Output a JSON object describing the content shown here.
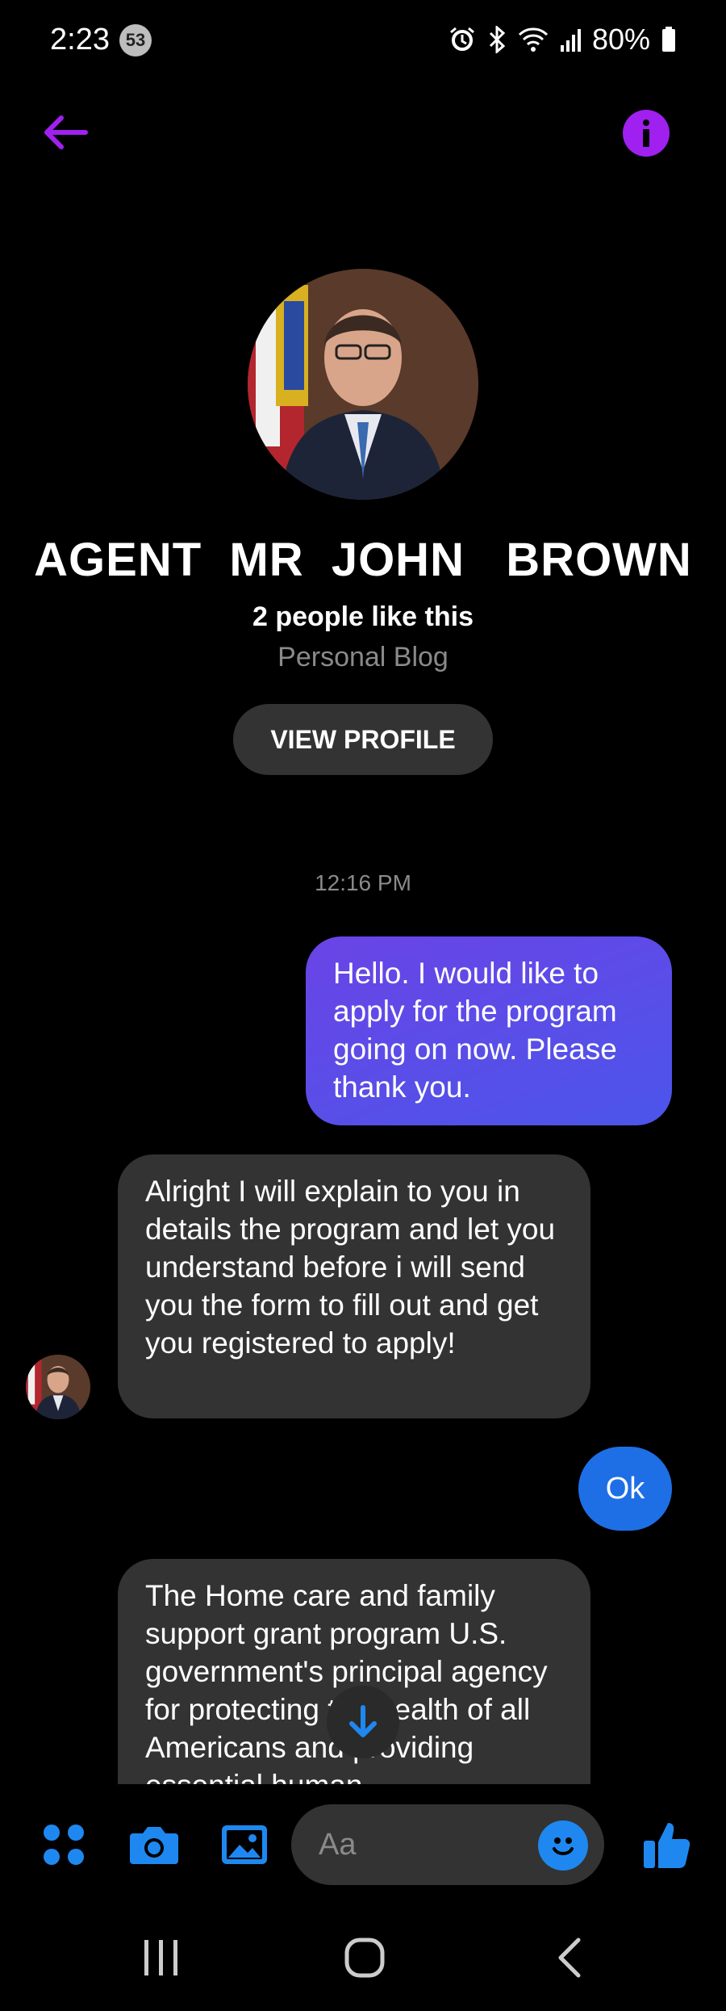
{
  "status_bar": {
    "time": "2:23",
    "notification_count": "53",
    "battery": "80%",
    "icons": [
      "alarm-icon",
      "bluetooth-icon",
      "wifi-icon",
      "signal-icon",
      "battery-icon"
    ]
  },
  "header": {
    "back_icon": "arrow-left-icon",
    "info_icon": "info-icon",
    "accent_color": "#a020f0"
  },
  "profile": {
    "name": "AGENT  MR  JOHN   BROWN",
    "likes": "2 people like this",
    "category": "Personal Blog",
    "view_profile_label": "VIEW PROFILE"
  },
  "conversation": {
    "timestamp": "12:16 PM",
    "messages": [
      {
        "direction": "sent",
        "text": "Hello. I would like to apply for the program going on now. Please thank you."
      },
      {
        "direction": "received",
        "text": "Alright I will explain to you in details the program and let you understand before i will send you the form to fill out and get you registered to apply!"
      },
      {
        "direction": "sent",
        "text": "Ok"
      },
      {
        "direction": "received",
        "text": "The Home care and family support grant program U.S. government's principal agency for protecting the health of all Americans and providing essential human"
      }
    ]
  },
  "composer": {
    "placeholder": "Aa",
    "tools": [
      "apps-icon",
      "camera-icon",
      "gallery-icon"
    ],
    "emoji_icon": "smiley-icon",
    "like_icon": "thumbs-up-icon",
    "accent_color": "#1e88f0"
  },
  "nav_bar": [
    "recents-icon",
    "home-icon",
    "back-icon"
  ]
}
